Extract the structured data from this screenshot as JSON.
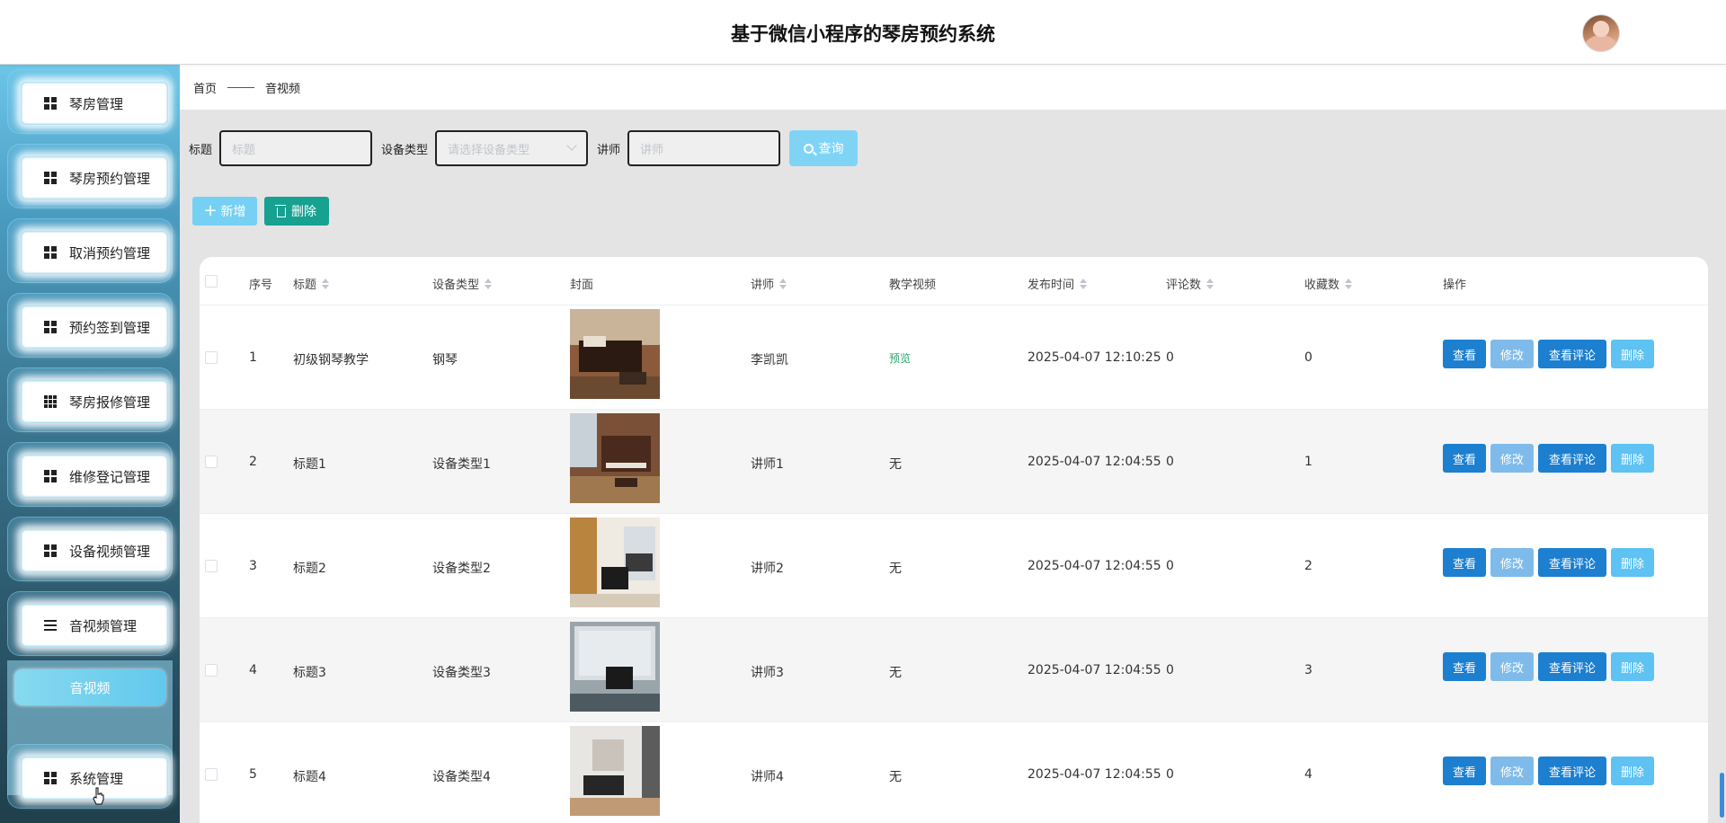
{
  "header": {
    "title": "基于微信小程序的琴房预约系统"
  },
  "sidebar": {
    "items": [
      {
        "label": "琴房管理",
        "icon": "grid-icon"
      },
      {
        "label": "琴房预约管理",
        "icon": "grid-icon"
      },
      {
        "label": "取消预约管理",
        "icon": "grid-icon"
      },
      {
        "label": "预约签到管理",
        "icon": "grid-icon"
      },
      {
        "label": "琴房报修管理",
        "icon": "nine-grid-icon"
      },
      {
        "label": "维修登记管理",
        "icon": "grid-icon"
      },
      {
        "label": "设备视频管理",
        "icon": "grid-icon"
      },
      {
        "label": "音视频管理",
        "icon": "list-icon"
      },
      {
        "label": "系统管理",
        "icon": "grid-icon"
      }
    ],
    "sub_item": "音视频"
  },
  "breadcrumb": {
    "home": "首页",
    "current": "音视频"
  },
  "filters": {
    "title_label": "标题",
    "title_placeholder": "标题",
    "type_label": "设备类型",
    "type_placeholder": "请选择设备类型",
    "teacher_label": "讲师",
    "teacher_placeholder": "讲师",
    "search_label": "查询"
  },
  "actions": {
    "add_label": "新增",
    "delete_label": "删除"
  },
  "table": {
    "columns": [
      "序号",
      "标题",
      "设备类型",
      "封面",
      "讲师",
      "教学视频",
      "发布时间",
      "评论数",
      "收藏数",
      "操作"
    ],
    "rows": [
      {
        "index": "1",
        "title": "初级钢琴教学",
        "type": "钢琴",
        "teacher": "李凯凯",
        "video": "预览",
        "time": "2025-04-07 12:10:25",
        "comments": "0",
        "favorites": "0"
      },
      {
        "index": "2",
        "title": "标题1",
        "type": "设备类型1",
        "teacher": "讲师1",
        "video": "无",
        "time": "2025-04-07 12:04:55",
        "comments": "0",
        "favorites": "1"
      },
      {
        "index": "3",
        "title": "标题2",
        "type": "设备类型2",
        "teacher": "讲师2",
        "video": "无",
        "time": "2025-04-07 12:04:55",
        "comments": "0",
        "favorites": "2"
      },
      {
        "index": "4",
        "title": "标题3",
        "type": "设备类型3",
        "teacher": "讲师3",
        "video": "无",
        "time": "2025-04-07 12:04:55",
        "comments": "0",
        "favorites": "3"
      },
      {
        "index": "5",
        "title": "标题4",
        "type": "设备类型4",
        "teacher": "讲师4",
        "video": "无",
        "time": "2025-04-07 12:04:55",
        "comments": "0",
        "favorites": "4"
      }
    ],
    "op_labels": {
      "view": "查看",
      "edit": "修改",
      "comments": "查看评论",
      "delete": "删除"
    }
  },
  "colors": {
    "primary": "#1c7fd0",
    "accent": "#75d0f3",
    "danger_green": "#16a191"
  }
}
